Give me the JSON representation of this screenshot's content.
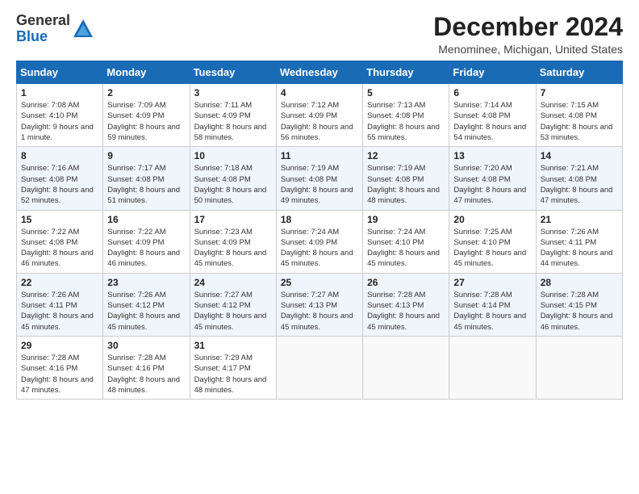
{
  "logo": {
    "text_general": "General",
    "text_blue": "Blue"
  },
  "header": {
    "title": "December 2024",
    "subtitle": "Menominee, Michigan, United States"
  },
  "weekdays": [
    "Sunday",
    "Monday",
    "Tuesday",
    "Wednesday",
    "Thursday",
    "Friday",
    "Saturday"
  ],
  "weeks": [
    [
      {
        "day": "1",
        "sunrise": "7:08 AM",
        "sunset": "4:10 PM",
        "daylight": "9 hours and 1 minute."
      },
      {
        "day": "2",
        "sunrise": "7:09 AM",
        "sunset": "4:09 PM",
        "daylight": "8 hours and 59 minutes."
      },
      {
        "day": "3",
        "sunrise": "7:11 AM",
        "sunset": "4:09 PM",
        "daylight": "8 hours and 58 minutes."
      },
      {
        "day": "4",
        "sunrise": "7:12 AM",
        "sunset": "4:09 PM",
        "daylight": "8 hours and 56 minutes."
      },
      {
        "day": "5",
        "sunrise": "7:13 AM",
        "sunset": "4:08 PM",
        "daylight": "8 hours and 55 minutes."
      },
      {
        "day": "6",
        "sunrise": "7:14 AM",
        "sunset": "4:08 PM",
        "daylight": "8 hours and 54 minutes."
      },
      {
        "day": "7",
        "sunrise": "7:15 AM",
        "sunset": "4:08 PM",
        "daylight": "8 hours and 53 minutes."
      }
    ],
    [
      {
        "day": "8",
        "sunrise": "7:16 AM",
        "sunset": "4:08 PM",
        "daylight": "8 hours and 52 minutes."
      },
      {
        "day": "9",
        "sunrise": "7:17 AM",
        "sunset": "4:08 PM",
        "daylight": "8 hours and 51 minutes."
      },
      {
        "day": "10",
        "sunrise": "7:18 AM",
        "sunset": "4:08 PM",
        "daylight": "8 hours and 50 minutes."
      },
      {
        "day": "11",
        "sunrise": "7:19 AM",
        "sunset": "4:08 PM",
        "daylight": "8 hours and 49 minutes."
      },
      {
        "day": "12",
        "sunrise": "7:19 AM",
        "sunset": "4:08 PM",
        "daylight": "8 hours and 48 minutes."
      },
      {
        "day": "13",
        "sunrise": "7:20 AM",
        "sunset": "4:08 PM",
        "daylight": "8 hours and 47 minutes."
      },
      {
        "day": "14",
        "sunrise": "7:21 AM",
        "sunset": "4:08 PM",
        "daylight": "8 hours and 47 minutes."
      }
    ],
    [
      {
        "day": "15",
        "sunrise": "7:22 AM",
        "sunset": "4:08 PM",
        "daylight": "8 hours and 46 minutes."
      },
      {
        "day": "16",
        "sunrise": "7:22 AM",
        "sunset": "4:09 PM",
        "daylight": "8 hours and 46 minutes."
      },
      {
        "day": "17",
        "sunrise": "7:23 AM",
        "sunset": "4:09 PM",
        "daylight": "8 hours and 45 minutes."
      },
      {
        "day": "18",
        "sunrise": "7:24 AM",
        "sunset": "4:09 PM",
        "daylight": "8 hours and 45 minutes."
      },
      {
        "day": "19",
        "sunrise": "7:24 AM",
        "sunset": "4:10 PM",
        "daylight": "8 hours and 45 minutes."
      },
      {
        "day": "20",
        "sunrise": "7:25 AM",
        "sunset": "4:10 PM",
        "daylight": "8 hours and 45 minutes."
      },
      {
        "day": "21",
        "sunrise": "7:26 AM",
        "sunset": "4:11 PM",
        "daylight": "8 hours and 44 minutes."
      }
    ],
    [
      {
        "day": "22",
        "sunrise": "7:26 AM",
        "sunset": "4:11 PM",
        "daylight": "8 hours and 45 minutes."
      },
      {
        "day": "23",
        "sunrise": "7:26 AM",
        "sunset": "4:12 PM",
        "daylight": "8 hours and 45 minutes."
      },
      {
        "day": "24",
        "sunrise": "7:27 AM",
        "sunset": "4:12 PM",
        "daylight": "8 hours and 45 minutes."
      },
      {
        "day": "25",
        "sunrise": "7:27 AM",
        "sunset": "4:13 PM",
        "daylight": "8 hours and 45 minutes."
      },
      {
        "day": "26",
        "sunrise": "7:28 AM",
        "sunset": "4:13 PM",
        "daylight": "8 hours and 45 minutes."
      },
      {
        "day": "27",
        "sunrise": "7:28 AM",
        "sunset": "4:14 PM",
        "daylight": "8 hours and 45 minutes."
      },
      {
        "day": "28",
        "sunrise": "7:28 AM",
        "sunset": "4:15 PM",
        "daylight": "8 hours and 46 minutes."
      }
    ],
    [
      {
        "day": "29",
        "sunrise": "7:28 AM",
        "sunset": "4:16 PM",
        "daylight": "8 hours and 47 minutes."
      },
      {
        "day": "30",
        "sunrise": "7:28 AM",
        "sunset": "4:16 PM",
        "daylight": "8 hours and 48 minutes."
      },
      {
        "day": "31",
        "sunrise": "7:29 AM",
        "sunset": "4:17 PM",
        "daylight": "8 hours and 48 minutes."
      },
      null,
      null,
      null,
      null
    ]
  ],
  "labels": {
    "sunrise": "Sunrise:",
    "sunset": "Sunset:",
    "daylight": "Daylight:"
  }
}
